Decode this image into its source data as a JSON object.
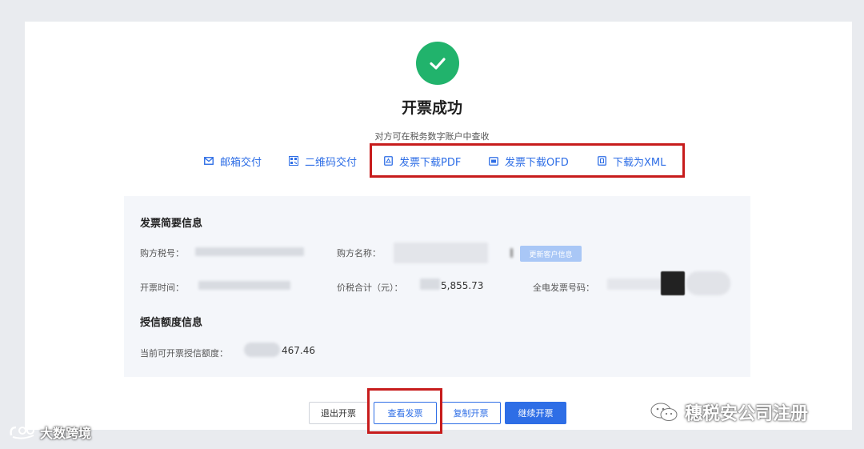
{
  "header": {
    "title": "开票成功",
    "subtitle": "对方可在税务数字账户中查收"
  },
  "actions": [
    {
      "label": "邮箱交付",
      "icon": "mail-icon"
    },
    {
      "label": "二维码交付",
      "icon": "qrcode-icon"
    },
    {
      "label": "发票下载PDF",
      "icon": "pdf-file-icon"
    },
    {
      "label": "发票下载OFD",
      "icon": "ofd-file-icon"
    },
    {
      "label": "下载为XML",
      "icon": "xml-file-icon"
    }
  ],
  "invoice_summary": {
    "title": "发票简要信息",
    "buyer_tax_no_label": "购方税号：",
    "buyer_name_label": "购方名称：",
    "update_customer_label": "更新客户信息",
    "issue_time_label": "开票时间：",
    "total_label": "价税合计（元）：",
    "total_value": "5,855.73",
    "einvoice_no_label": "全电发票号码："
  },
  "credit_info": {
    "title": "授信额度信息",
    "available_label": "当前可开票授信额度：",
    "available_value": "467.46"
  },
  "buttons": {
    "exit": "退出开票",
    "view": "查看发票",
    "copy": "复制开票",
    "continue": "继续开票"
  },
  "watermarks": {
    "right": "穗税安公司注册",
    "left": "大数跨境"
  },
  "colors": {
    "accent": "#2e6ee6",
    "success": "#21b36c",
    "highlight": "#c71c1c"
  }
}
